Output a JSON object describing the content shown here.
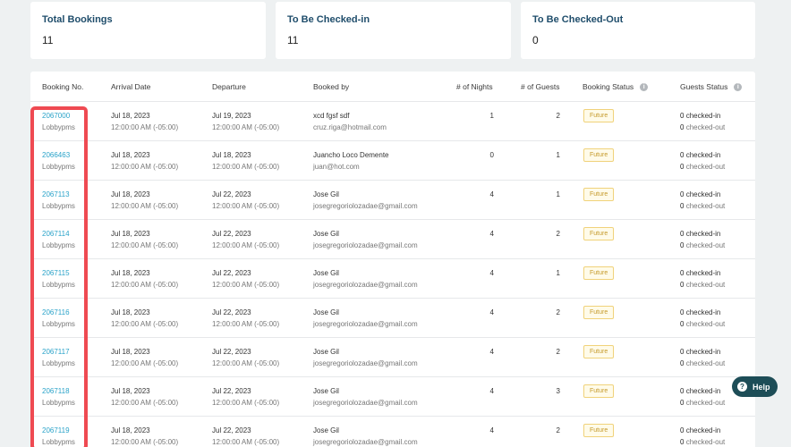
{
  "summary": {
    "total_bookings": {
      "label": "Total Bookings",
      "value": "11"
    },
    "to_be_checked_in": {
      "label": "To Be Checked-in",
      "value": "11"
    },
    "to_be_checked_out": {
      "label": "To Be Checked-Out",
      "value": "0"
    }
  },
  "table": {
    "headers": {
      "booking_no": "Booking No.",
      "arrival": "Arrival Date",
      "departure": "Departure",
      "booked_by": "Booked by",
      "nights": "# of Nights",
      "guests": "# of Guests",
      "booking_status": "Booking Status",
      "guests_status": "Guests Status"
    },
    "rows": [
      {
        "booking_no": "2067000",
        "source": "Lobbypms",
        "arrival_date": "Jul 18, 2023",
        "arrival_time": "12:00:00 AM (-05:00)",
        "departure_date": "Jul 19, 2023",
        "departure_time": "12:00:00 AM (-05:00)",
        "name": "xcd fgsf sdf",
        "email": "cruz.riga@hotmail.com",
        "nights": "1",
        "guests": "2",
        "status": "Future",
        "checked_in": "0",
        "checked_out": "0"
      },
      {
        "booking_no": "2066463",
        "source": "Lobbypms",
        "arrival_date": "Jul 18, 2023",
        "arrival_time": "12:00:00 AM (-05:00)",
        "departure_date": "Jul 18, 2023",
        "departure_time": "12:00:00 AM (-05:00)",
        "name": "Juancho Loco Demente",
        "email": "juan@hot.com",
        "nights": "0",
        "guests": "1",
        "status": "Future",
        "checked_in": "0",
        "checked_out": "0"
      },
      {
        "booking_no": "2067113",
        "source": "Lobbypms",
        "arrival_date": "Jul 18, 2023",
        "arrival_time": "12:00:00 AM (-05:00)",
        "departure_date": "Jul 22, 2023",
        "departure_time": "12:00:00 AM (-05:00)",
        "name": "Jose Gil",
        "email": "josegregoriolozadae@gmail.com",
        "nights": "4",
        "guests": "1",
        "status": "Future",
        "checked_in": "0",
        "checked_out": "0"
      },
      {
        "booking_no": "2067114",
        "source": "Lobbypms",
        "arrival_date": "Jul 18, 2023",
        "arrival_time": "12:00:00 AM (-05:00)",
        "departure_date": "Jul 22, 2023",
        "departure_time": "12:00:00 AM (-05:00)",
        "name": "Jose Gil",
        "email": "josegregoriolozadae@gmail.com",
        "nights": "4",
        "guests": "2",
        "status": "Future",
        "checked_in": "0",
        "checked_out": "0"
      },
      {
        "booking_no": "2067115",
        "source": "Lobbypms",
        "arrival_date": "Jul 18, 2023",
        "arrival_time": "12:00:00 AM (-05:00)",
        "departure_date": "Jul 22, 2023",
        "departure_time": "12:00:00 AM (-05:00)",
        "name": "Jose Gil",
        "email": "josegregoriolozadae@gmail.com",
        "nights": "4",
        "guests": "1",
        "status": "Future",
        "checked_in": "0",
        "checked_out": "0"
      },
      {
        "booking_no": "2067116",
        "source": "Lobbypms",
        "arrival_date": "Jul 18, 2023",
        "arrival_time": "12:00:00 AM (-05:00)",
        "departure_date": "Jul 22, 2023",
        "departure_time": "12:00:00 AM (-05:00)",
        "name": "Jose Gil",
        "email": "josegregoriolozadae@gmail.com",
        "nights": "4",
        "guests": "2",
        "status": "Future",
        "checked_in": "0",
        "checked_out": "0"
      },
      {
        "booking_no": "2067117",
        "source": "Lobbypms",
        "arrival_date": "Jul 18, 2023",
        "arrival_time": "12:00:00 AM (-05:00)",
        "departure_date": "Jul 22, 2023",
        "departure_time": "12:00:00 AM (-05:00)",
        "name": "Jose Gil",
        "email": "josegregoriolozadae@gmail.com",
        "nights": "4",
        "guests": "2",
        "status": "Future",
        "checked_in": "0",
        "checked_out": "0"
      },
      {
        "booking_no": "2067118",
        "source": "Lobbypms",
        "arrival_date": "Jul 18, 2023",
        "arrival_time": "12:00:00 AM (-05:00)",
        "departure_date": "Jul 22, 2023",
        "departure_time": "12:00:00 AM (-05:00)",
        "name": "Jose Gil",
        "email": "josegregoriolozadae@gmail.com",
        "nights": "4",
        "guests": "3",
        "status": "Future",
        "checked_in": "0",
        "checked_out": "0"
      },
      {
        "booking_no": "2067119",
        "source": "Lobbypms",
        "arrival_date": "Jul 18, 2023",
        "arrival_time": "12:00:00 AM (-05:00)",
        "departure_date": "Jul 22, 2023",
        "departure_time": "12:00:00 AM (-05:00)",
        "name": "Jose Gil",
        "email": "josegregoriolozadae@gmail.com",
        "nights": "4",
        "guests": "2",
        "status": "Future",
        "checked_in": "0",
        "checked_out": "0"
      }
    ],
    "checked_in_suffix": "checked-in",
    "checked_out_suffix": "checked-out"
  },
  "help": {
    "label": "Help",
    "icon": "question-icon"
  },
  "colors": {
    "link": "#2aa3c9",
    "highlight": "#ef4a52",
    "badge": "#c59a2b",
    "help_bg": "#1d4d57"
  }
}
